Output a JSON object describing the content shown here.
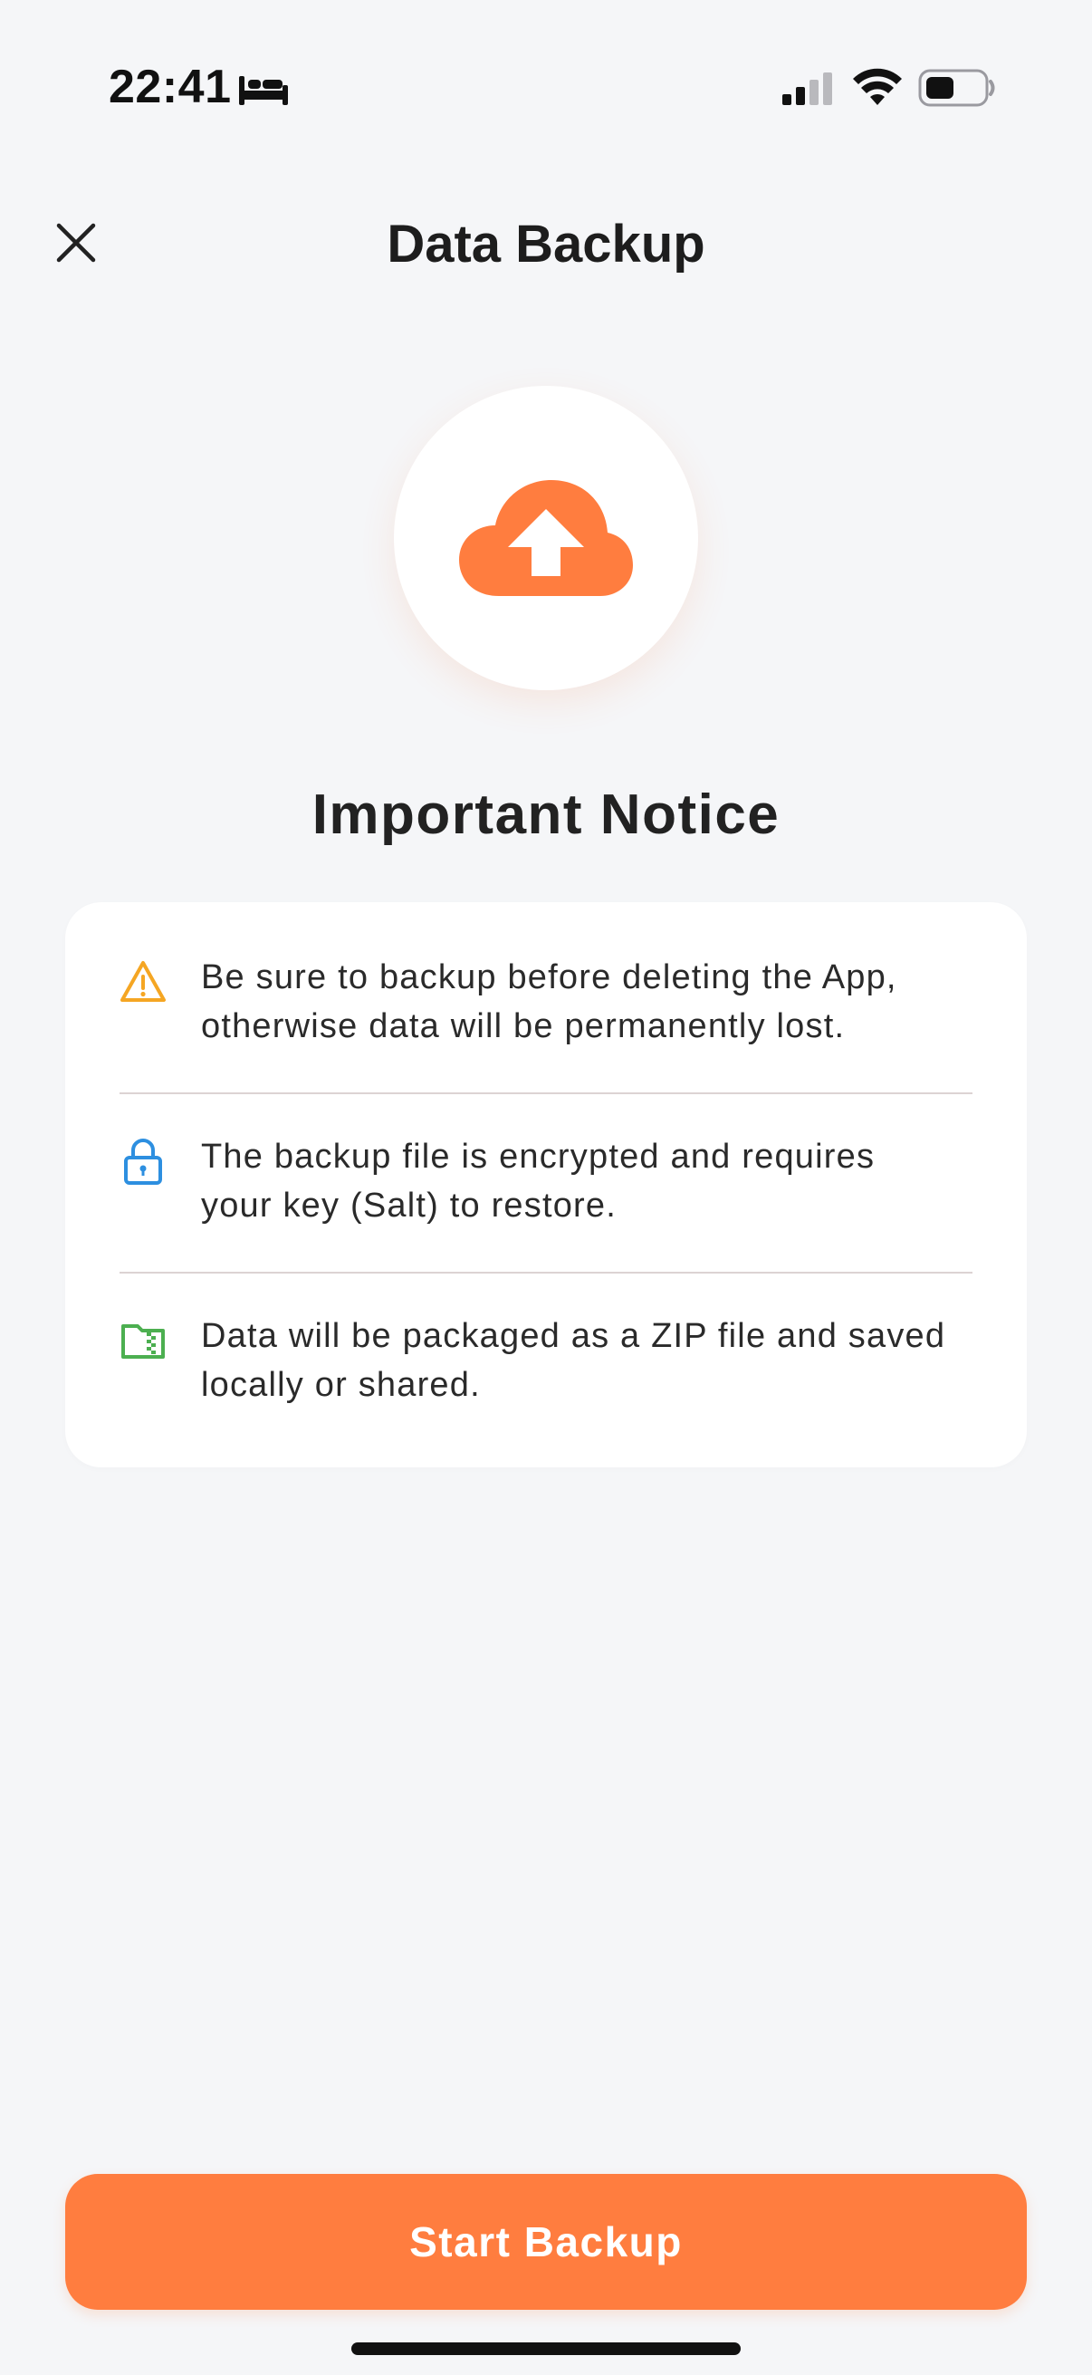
{
  "status_bar": {
    "time": "22:41",
    "icons": [
      "bed-icon",
      "cellular-signal-icon",
      "wifi-icon",
      "battery-icon"
    ]
  },
  "header": {
    "title": "Data Backup",
    "close_icon": "close-icon"
  },
  "hero": {
    "icon": "cloud-upload-icon",
    "accent_color": "#ff7d3f"
  },
  "notice": {
    "title": "Important Notice",
    "items": [
      {
        "icon": "warning-icon",
        "icon_color": "#f5a623",
        "text": "Be sure to backup before deleting the App, otherwise data will be permanently lost."
      },
      {
        "icon": "lock-icon",
        "icon_color": "#2d8fe0",
        "text": "The backup file is encrypted and requires your key (Salt) to restore."
      },
      {
        "icon": "zip-folder-icon",
        "icon_color": "#4caf50",
        "text": "Data will be packaged as a ZIP file and saved locally or shared."
      }
    ]
  },
  "actions": {
    "start_label": "Start Backup"
  }
}
